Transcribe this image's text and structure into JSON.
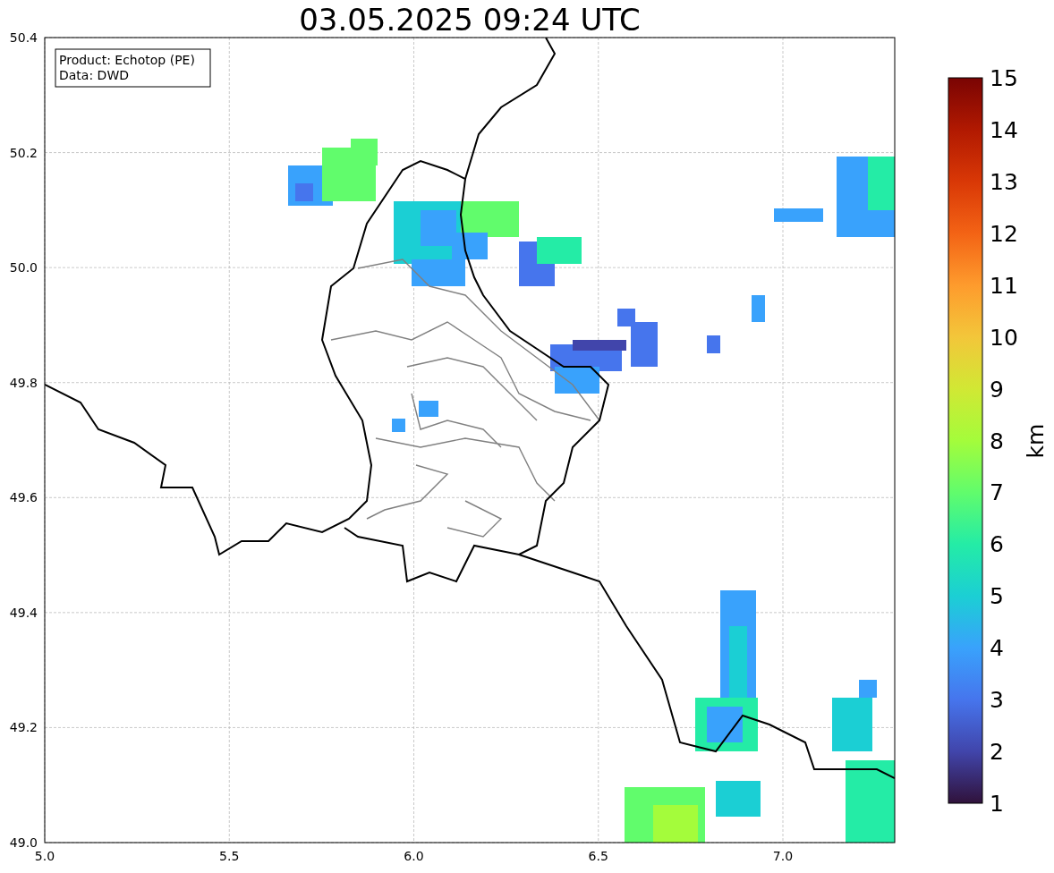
{
  "title": "03.05.2025 09:24 UTC",
  "legend": [
    "Product: Echotop (PE)",
    "Data: DWD"
  ],
  "map": {
    "xticks": [
      "5.0",
      "5.5",
      "6.0",
      "6.5",
      "7.0"
    ],
    "yticks": [
      "50.4",
      "50.2",
      "50.0",
      "49.8",
      "49.6",
      "49.4",
      "49.2",
      "49.0"
    ]
  },
  "colorbar": {
    "label": "km",
    "ticks": [
      "15",
      "14",
      "13",
      "12",
      "11",
      "10",
      "9",
      "8",
      "7",
      "6",
      "5",
      "4",
      "3",
      "2",
      "1"
    ]
  }
}
